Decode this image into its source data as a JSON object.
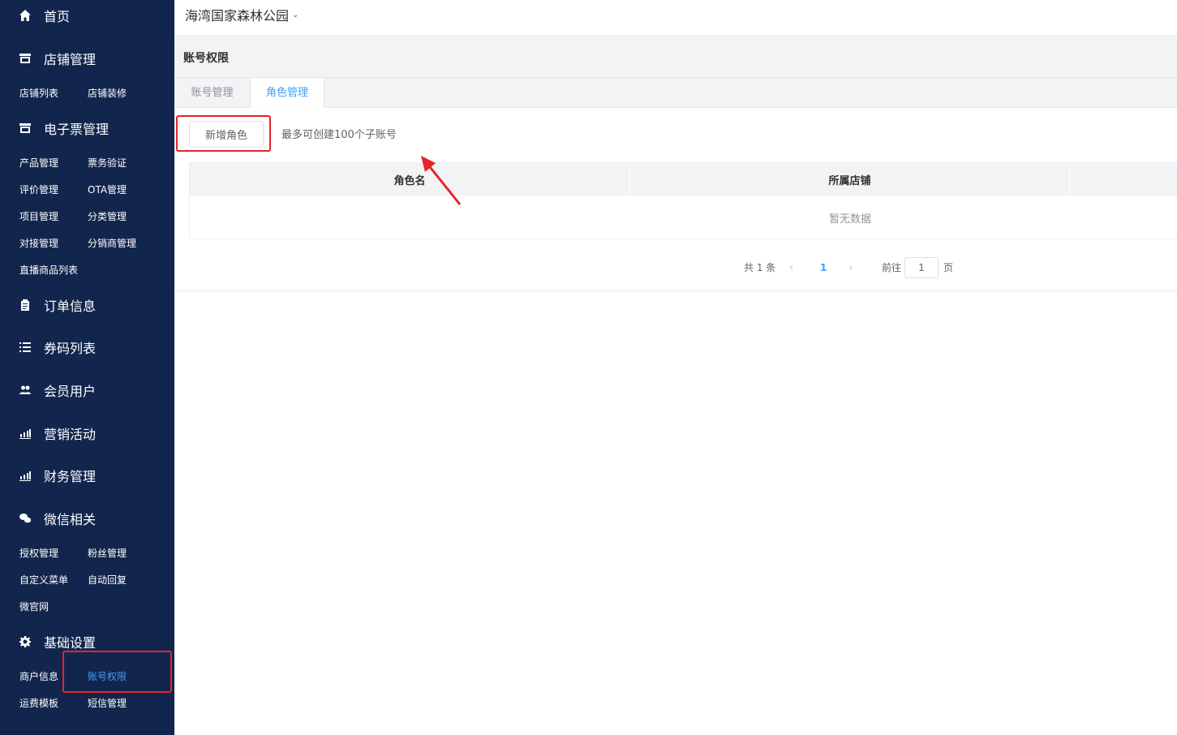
{
  "sidebar": {
    "home": "首页",
    "store": {
      "title": "店铺管理",
      "items": [
        "店铺列表",
        "店铺装修"
      ]
    },
    "eticket": {
      "title": "电子票管理",
      "items": [
        "产品管理",
        "票务验证",
        "评价管理",
        "OTA管理",
        "项目管理",
        "分类管理",
        "对接管理",
        "分销商管理",
        "直播商品列表"
      ]
    },
    "orders": "订单信息",
    "coupons": "券码列表",
    "members": "会员用户",
    "marketing": "营销活动",
    "finance": "财务管理",
    "wechat": {
      "title": "微信相关",
      "items": [
        "授权管理",
        "粉丝管理",
        "自定义菜单",
        "自动回复",
        "微官网"
      ]
    },
    "basic": {
      "title": "基础设置",
      "items": [
        "商户信息",
        "账号权限",
        "运费模板",
        "短信管理"
      ]
    }
  },
  "header": {
    "shop_name": "海湾国家森林公园"
  },
  "page": {
    "title": "账号权限"
  },
  "tabs": [
    "账号管理",
    "角色管理"
  ],
  "toolbar": {
    "add_label": "新增角色",
    "hint": "最多可创建100个子账号"
  },
  "table": {
    "columns": [
      "角色名",
      "所属店铺"
    ],
    "empty_text": "暂无数据"
  },
  "pagination": {
    "total_text": "共 1 条",
    "current_page": "1",
    "goto_label": "前往",
    "goto_value": "1",
    "page_unit": "页"
  },
  "colors": {
    "sidebar_bg": "#12264d",
    "accent": "#409eff",
    "highlight": "#e5242b"
  }
}
